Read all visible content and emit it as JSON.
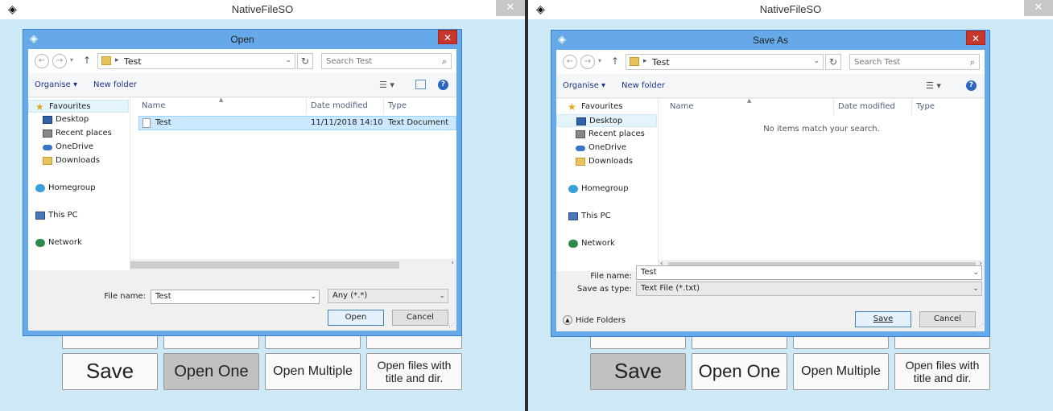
{
  "left_app": {
    "title": "NativeFileSO",
    "close_glyph": "✕",
    "buttons_partial": [
      "",
      "",
      "",
      ""
    ],
    "buttons": [
      {
        "label": "Save",
        "size": "big",
        "pressed": false
      },
      {
        "label": "Open One",
        "size": "mid",
        "pressed": true
      },
      {
        "label": "Open Multiple",
        "size": "med",
        "pressed": false
      },
      {
        "label": "Open files with\ntitle and dir.",
        "size": "small",
        "pressed": false
      }
    ],
    "dialog": {
      "title": "Open",
      "close_glyph": "✕",
      "address": {
        "crumb": "Test",
        "search_placeholder": "Search Test"
      },
      "toolbar": {
        "organise": "Organise ▾",
        "new_folder": "New folder"
      },
      "nav": [
        {
          "label": "Favourites",
          "icon": "star-icon"
        },
        {
          "label": "Desktop",
          "icon": "desktop-icon"
        },
        {
          "label": "Recent places",
          "icon": "recent-places-icon"
        },
        {
          "label": "OneDrive",
          "icon": "onedrive-icon"
        },
        {
          "label": "Downloads",
          "icon": "downloads-icon"
        },
        {
          "label": "Homegroup",
          "icon": "homegroup-icon"
        },
        {
          "label": "This PC",
          "icon": "this-pc-icon"
        },
        {
          "label": "Network",
          "icon": "network-icon"
        }
      ],
      "columns": {
        "name": "Name",
        "date": "Date modified",
        "type": "Type"
      },
      "files": [
        {
          "name": "Test",
          "date": "11/11/2018 14:10",
          "type": "Text Document"
        }
      ],
      "file_name_label": "File name:",
      "file_name_value": "Test",
      "filter_value": "Any (*.*)",
      "primary_button": "Open",
      "cancel_button": "Cancel"
    }
  },
  "right_app": {
    "title": "NativeFileSO",
    "close_glyph": "✕",
    "buttons": [
      {
        "label": "Save",
        "size": "big",
        "pressed": true
      },
      {
        "label": "Open One",
        "size": "big",
        "pressed": false
      },
      {
        "label": "Open Multiple",
        "size": "med",
        "pressed": false
      },
      {
        "label": "Open files with\ntitle and dir.",
        "size": "small",
        "pressed": false
      }
    ],
    "dialog": {
      "title": "Save As",
      "close_glyph": "✕",
      "address": {
        "crumb": "Test",
        "search_placeholder": "Search Test"
      },
      "toolbar": {
        "organise": "Organise ▾",
        "new_folder": "New folder"
      },
      "nav": [
        {
          "label": "Favourites",
          "icon": "star-icon"
        },
        {
          "label": "Desktop",
          "icon": "desktop-icon"
        },
        {
          "label": "Recent places",
          "icon": "recent-places-icon"
        },
        {
          "label": "OneDrive",
          "icon": "onedrive-icon"
        },
        {
          "label": "Downloads",
          "icon": "downloads-icon"
        },
        {
          "label": "Homegroup",
          "icon": "homegroup-icon"
        },
        {
          "label": "This PC",
          "icon": "this-pc-icon"
        },
        {
          "label": "Network",
          "icon": "network-icon"
        }
      ],
      "columns": {
        "name": "Name",
        "date": "Date modified",
        "type": "Type"
      },
      "empty_message": "No items match your search.",
      "file_name_label": "File name:",
      "file_name_value": "Test",
      "save_type_label": "Save as type:",
      "save_type_value": "Text File (*.txt)",
      "hide_folders": "Hide Folders",
      "primary_button": "Save",
      "cancel_button": "Cancel"
    }
  },
  "colors": {
    "app_background": "#cde8f6",
    "dialog_frame": "#65a9e8",
    "close_red": "#c7362b",
    "selection": "#cce8ff"
  }
}
